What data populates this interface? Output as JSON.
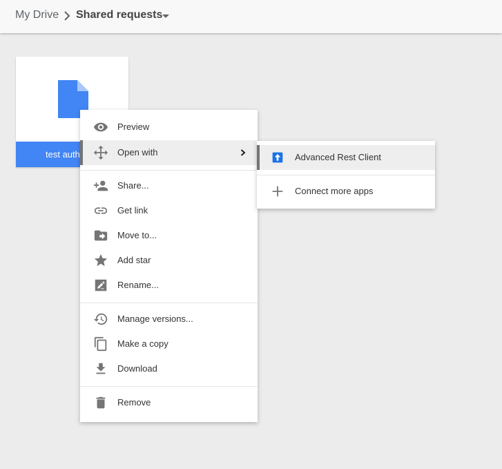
{
  "breadcrumb": {
    "root": "My Drive",
    "current": "Shared requests"
  },
  "file": {
    "name": "test auth",
    "accent_color": "#4285f4"
  },
  "context_menu": {
    "items": [
      {
        "label": "Preview",
        "icon": "eye-icon"
      },
      {
        "label": "Open with",
        "icon": "move-arrows-icon"
      },
      {
        "label": "Share...",
        "icon": "add-person-icon"
      },
      {
        "label": "Get link",
        "icon": "link-icon"
      },
      {
        "label": "Move to...",
        "icon": "folder-move-icon"
      },
      {
        "label": "Add star",
        "icon": "star-icon"
      },
      {
        "label": "Rename...",
        "icon": "edit-icon"
      },
      {
        "label": "Manage versions...",
        "icon": "history-icon"
      },
      {
        "label": "Make a copy",
        "icon": "copy-icon"
      },
      {
        "label": "Download",
        "icon": "download-icon"
      },
      {
        "label": "Remove",
        "icon": "trash-icon"
      }
    ]
  },
  "open_with_submenu": {
    "items": [
      {
        "label": "Advanced Rest Client",
        "icon": "arc-app-icon"
      },
      {
        "label": "Connect more apps",
        "icon": "plus-icon"
      }
    ]
  }
}
